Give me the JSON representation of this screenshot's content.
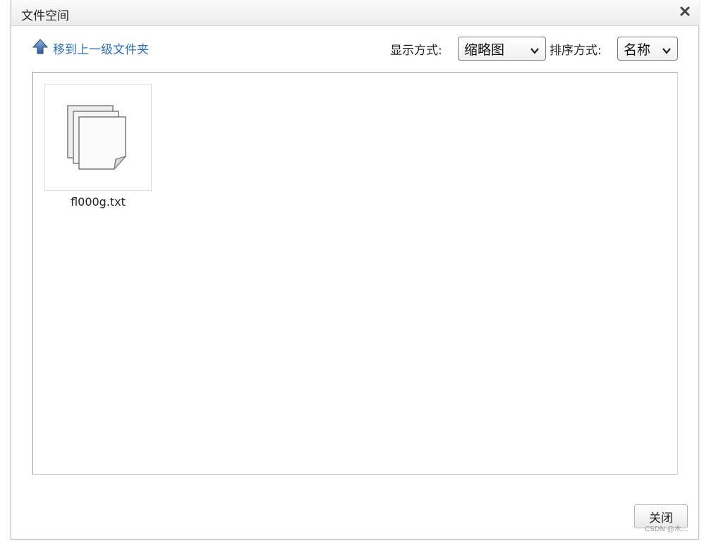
{
  "dialog": {
    "title": "文件空间",
    "close_icon": "close-icon"
  },
  "toolbar": {
    "up_folder_label": "移到上一级文件夹",
    "up_folder_icon": "arrow-up-icon",
    "display_mode_label": "显示方式:",
    "display_mode_value": "缩略图",
    "sort_label": "排序方式:",
    "sort_value": "名称"
  },
  "files": [
    {
      "name": "fl000g.txt",
      "icon": "document-stack-icon"
    }
  ],
  "footer": {
    "close_button_label": "关闭"
  },
  "watermark": "CSDN @木…",
  "colors": {
    "link": "#2c6fbb",
    "title_bar": "#ececec"
  }
}
